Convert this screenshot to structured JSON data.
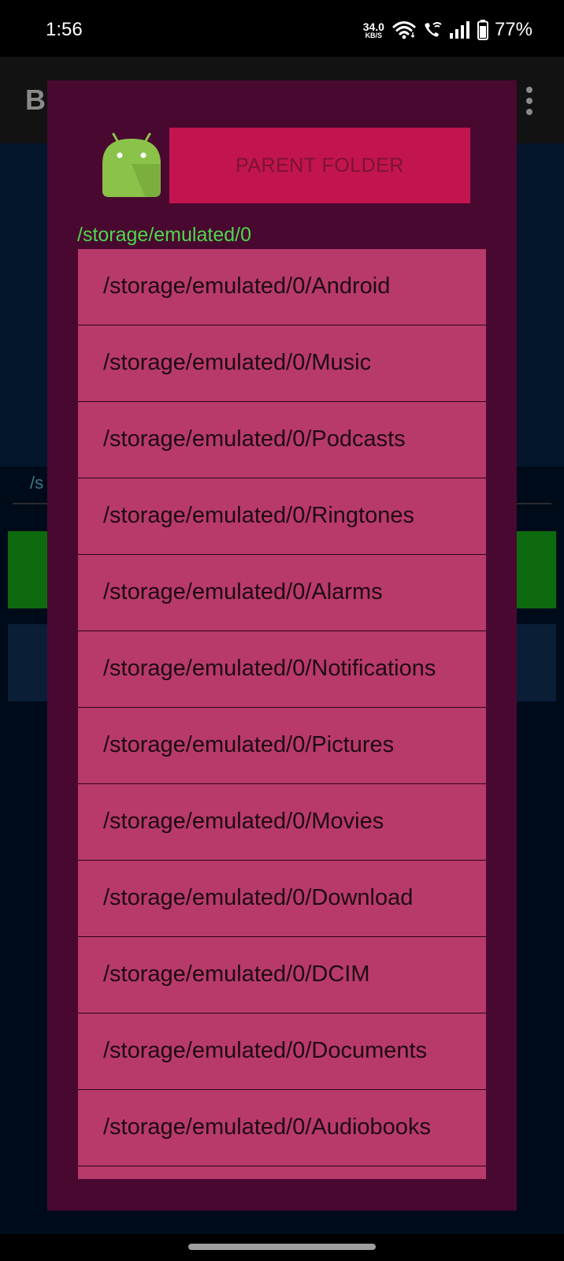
{
  "status_bar": {
    "time": "1:56",
    "net_speed_value": "34.0",
    "net_speed_unit": "KB/S",
    "battery_percent": "77%"
  },
  "background_app": {
    "title_initial": "B",
    "path_fragment": "/s"
  },
  "dialog": {
    "parent_folder_label": "PARENT FOLDER",
    "current_path": "/storage/emulated/0",
    "items": [
      {
        "label": "/storage/emulated/0/Android"
      },
      {
        "label": "/storage/emulated/0/Music"
      },
      {
        "label": "/storage/emulated/0/Podcasts"
      },
      {
        "label": "/storage/emulated/0/Ringtones"
      },
      {
        "label": "/storage/emulated/0/Alarms"
      },
      {
        "label": "/storage/emulated/0/Notifications"
      },
      {
        "label": "/storage/emulated/0/Pictures"
      },
      {
        "label": "/storage/emulated/0/Movies"
      },
      {
        "label": "/storage/emulated/0/Download"
      },
      {
        "label": "/storage/emulated/0/DCIM"
      },
      {
        "label": "/storage/emulated/0/Documents"
      },
      {
        "label": "/storage/emulated/0/Audiobooks"
      }
    ]
  },
  "colors": {
    "dialog_bg": "#490830",
    "parent_button": "#c2144f",
    "list_item_bg": "#b83a6a",
    "current_path_text": "#4cd94c",
    "android_green": "#8bc34a"
  },
  "icons": [
    "wifi-icon",
    "wifi-calling-icon",
    "signal-icon",
    "battery-icon",
    "android-icon",
    "overflow-menu-icon"
  ]
}
